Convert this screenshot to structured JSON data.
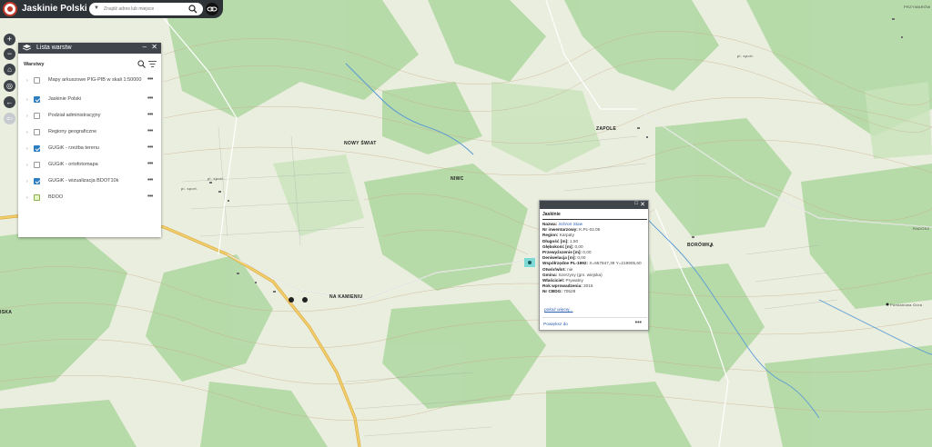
{
  "app": {
    "title": "Jaskinie Polski"
  },
  "search": {
    "placeholder": "Znajdź adres lub miejsce"
  },
  "map_controls": {
    "zoom_in": "+",
    "zoom_out": "−",
    "home": "⌂",
    "locate": "◎",
    "back": "←",
    "forward": "⇦"
  },
  "layer_panel": {
    "title": "Lista warstw",
    "minimize": "–",
    "close": "✕",
    "section_label": "Warstwy",
    "layers": [
      {
        "label": "Mapy arkuszowe PIG-PIB w skali 1:50000",
        "checked": false
      },
      {
        "label": "Jaskinie Polski",
        "checked": true
      },
      {
        "label": "Podział administracyjny",
        "checked": false
      },
      {
        "label": "Regiony geograficzne",
        "checked": false
      },
      {
        "label": "GUGiK - rzeźba terenu",
        "checked": true
      },
      {
        "label": "GUGiK - ortofotomapa",
        "checked": false
      },
      {
        "label": "GUGiK - wizualizacja BDOT10k",
        "checked": true
      },
      {
        "label": "BDOO",
        "checked": "partial"
      }
    ],
    "dots": "•••",
    "chevron": "›"
  },
  "popup": {
    "maximize": "□",
    "close": "✕",
    "title": "Jaskinie",
    "fields": [
      {
        "key": "Nazwa:",
        "value": "Schron Staw",
        "is_name": true
      },
      {
        "key": "Nr inwentarzowy:",
        "value": "K.Pc-02.05"
      },
      {
        "key": "Region:",
        "value": "Karpaty"
      },
      {
        "key": "Długość [m]:",
        "value": "1,50"
      },
      {
        "key": "Głębokość [m]:",
        "value": "0,00"
      },
      {
        "key": "Przewyższenie [m]:",
        "value": "0,00"
      },
      {
        "key": "Deniwelacja [m]:",
        "value": "0,00"
      },
      {
        "key": "Współrzędne PL-1992:",
        "value": "X=657847,39 Y=219905,60"
      },
      {
        "key": "Otwór/wlot:",
        "value": "nie"
      },
      {
        "key": "Gmina:",
        "value": "Szerzyny (gm. wiejska)"
      },
      {
        "key": "Właściciel:",
        "value": "Prywatny"
      },
      {
        "key": "Rok wprowadzenia:",
        "value": "2015"
      },
      {
        "key": "Nr CBDG:",
        "value": "70528"
      }
    ],
    "more_link": "pokaż więcej...",
    "zoom_link": "Powiększ do",
    "dots": "•••"
  },
  "map_labels": [
    {
      "text": "NOWY ŚWIAT",
      "cls": ""
    },
    {
      "text": "ZAPOLE",
      "cls": ""
    },
    {
      "text": "BORÓWKA",
      "cls": ""
    },
    {
      "text": "NA KAMIENIU",
      "cls": ""
    },
    {
      "text": "PRZYWARÓW",
      "cls": "small"
    },
    {
      "text": "RADOSZ",
      "cls": "small"
    },
    {
      "text": "Pomianowa Góra",
      "cls": "small"
    },
    {
      "text": "ISKA",
      "cls": ""
    },
    {
      "text": "pl. sport.",
      "cls": "small"
    },
    {
      "text": "pl. sport.",
      "cls": "small"
    },
    {
      "text": "pl. sport.",
      "cls": "small"
    },
    {
      "text": "NIWC",
      "cls": ""
    }
  ],
  "colors": {
    "forest": "#a9d49a",
    "meadow": "#e9eedd",
    "contour": "#b89b7a",
    "road_main": "#e6b94a",
    "water": "#5b9bd5",
    "topbar": "#2e3338",
    "link": "#2a5db0"
  }
}
